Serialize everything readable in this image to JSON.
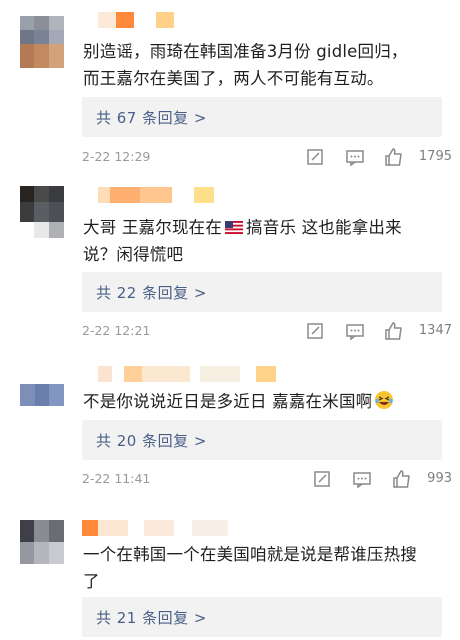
{
  "comments": [
    {
      "text_line1": "别造谣，雨琦在韩国准备3月份 gidle回归，",
      "text_line2": "而王嘉尔在美国了，两人不可能有互动。",
      "replies": "共 67 条回复 >",
      "time": "2-22 12:29",
      "likes": "1795"
    },
    {
      "text_line1_a": "大哥 王嘉尔现在在",
      "text_line1_b": "搞音乐 这也能拿出来",
      "text_line2": "说？闲得慌吧",
      "replies": "共 22 条回复 >",
      "time": "2-22 12:21",
      "likes": "1347"
    },
    {
      "text_line1": "不是你说说近日是多近日 嘉嘉在米国啊",
      "replies": "共 20 条回复 >",
      "time": "2-22 11:41",
      "likes": "993"
    },
    {
      "text_line1": "一个在韩国一个在美国咱就是说是帮谁压热搜",
      "text_line2": "了",
      "replies": "共 21 条回复 >"
    }
  ],
  "icons": {
    "share": "share-icon",
    "comment": "comment-icon",
    "like": "thumbs-up-icon",
    "flag": "us-flag-emoji",
    "laugh": "laughing-emoji"
  },
  "colors": {
    "reply_link": "#4a5f86",
    "reply_bg": "#f2f2f2",
    "meta_text": "#9a9a9a"
  }
}
